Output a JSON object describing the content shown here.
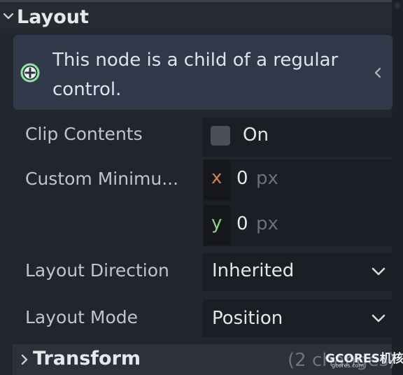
{
  "section": {
    "title": "Layout"
  },
  "info": {
    "message": "This node is a child of a regular control."
  },
  "properties": {
    "clip_contents": {
      "label": "Clip Contents",
      "value_label": "On",
      "checked": false
    },
    "custom_minimum": {
      "label": "Custom Minimu...",
      "x": {
        "axis": "x",
        "value": "0",
        "unit": "px"
      },
      "y": {
        "axis": "y",
        "value": "0",
        "unit": "px"
      }
    },
    "layout_direction": {
      "label": "Layout Direction",
      "value": "Inherited"
    },
    "layout_mode": {
      "label": "Layout Mode",
      "value": "Position"
    }
  },
  "transform": {
    "title": "Transform",
    "changes": "(2 changes)"
  },
  "watermark": {
    "text": "GCORES机核",
    "sub": "gcores.com"
  },
  "colors": {
    "background": "#21252c",
    "info_box": "#30394a",
    "plus_icon": "#8fe3a3",
    "axis_x": "#d4805f",
    "axis_y": "#8fcf8a"
  },
  "icons": {
    "section_chevron": "chevron-down-icon",
    "info_icon": "plus-circle-icon",
    "info_collapse": "chevron-left-icon",
    "dropdown": "chevron-down-icon",
    "transform_chevron": "chevron-right-icon"
  }
}
